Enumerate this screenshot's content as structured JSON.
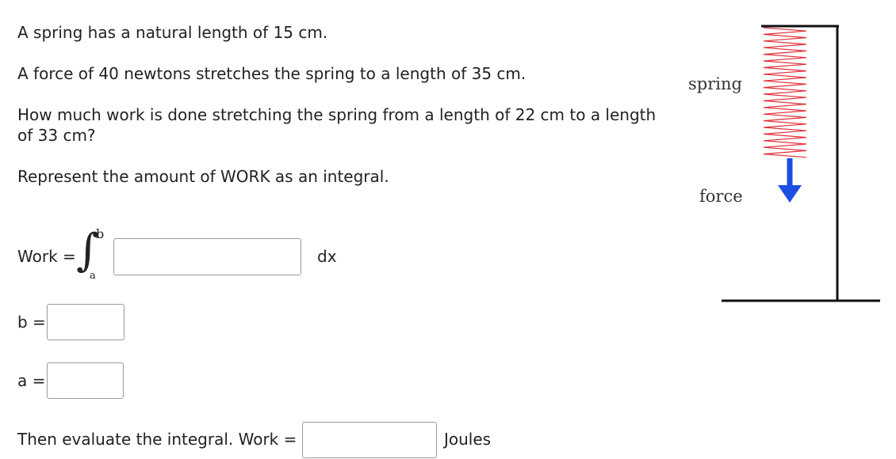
{
  "problem": {
    "line1": "A spring has a natural length of 15 cm.",
    "line2": "A force of 40 newtons stretches the spring to a length of 35 cm.",
    "line3a": "How much work is done stretching the spring from a length of 22 cm to a length",
    "line3b": "of 33 cm?",
    "line4": "Represent the amount of WORK as an integral."
  },
  "integral": {
    "work_label": "Work =",
    "upper_limit": "b",
    "lower_limit": "a",
    "integrand_value": "",
    "differential": "dx"
  },
  "limits": {
    "b_label": "b =",
    "b_value": "",
    "a_label": "a =",
    "a_value": ""
  },
  "evaluate": {
    "label": "Then evaluate the integral. Work =",
    "value": "",
    "unit": "Joules"
  },
  "figure": {
    "spring_label": "spring",
    "force_label": "force",
    "spring_color": "#e0303a",
    "arrow_color": "#1a4fe0"
  }
}
